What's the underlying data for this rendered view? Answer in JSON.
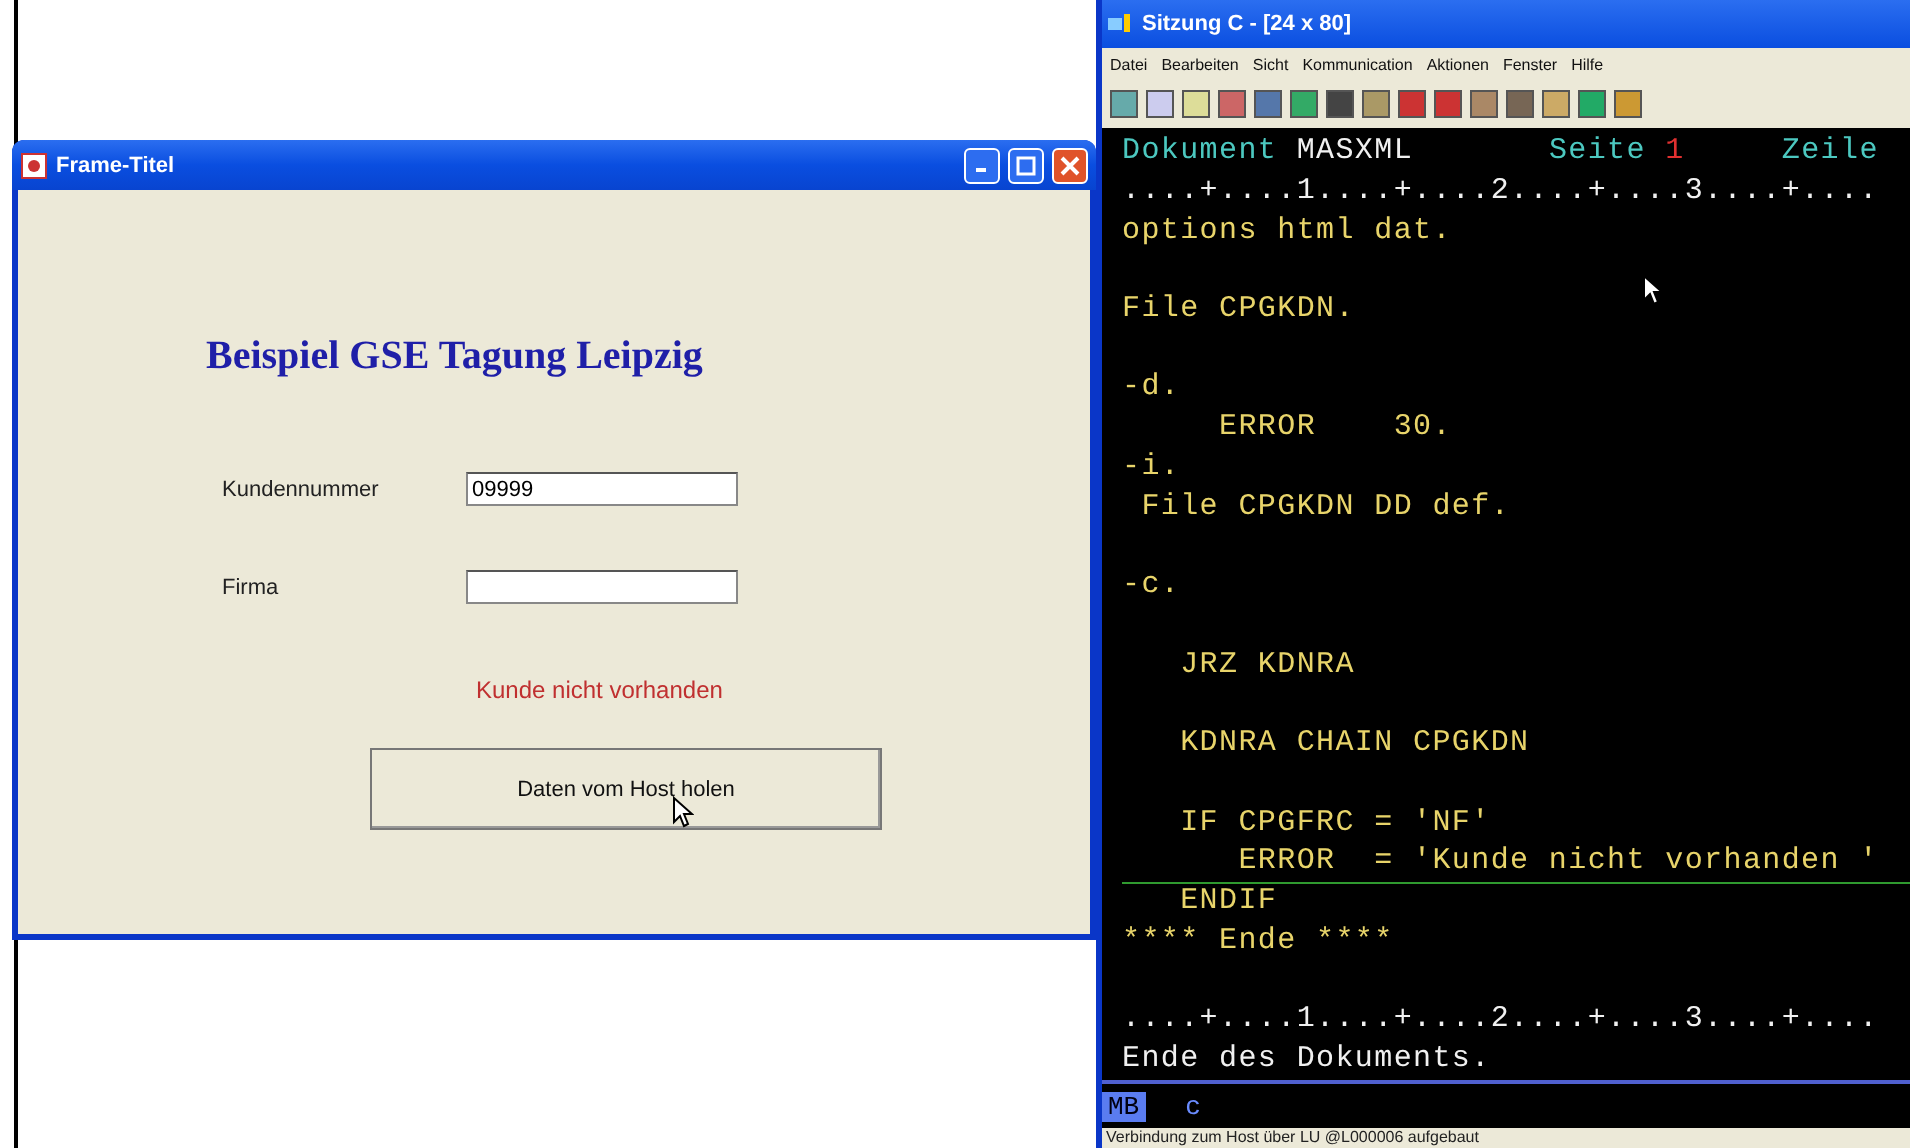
{
  "frame_window": {
    "title": "Frame-Titel",
    "heading": "Beispiel GSE Tagung Leipzig",
    "fields": [
      {
        "label": "Kundennummer",
        "value": "09999"
      },
      {
        "label": "Firma"
      }
    ],
    "message": "Kunde nicht vorhanden",
    "button": "Daten vom Host holen"
  },
  "terminal_window": {
    "title": "Sitzung C - [24 x 80]",
    "menu": [
      "Datei",
      "Bearbeiten",
      "Sicht",
      "Kommunication",
      "Aktionen",
      "Fenster",
      "Hilfe"
    ],
    "lines": [
      {
        "kind": "text",
        "segments": [
          {
            "kind": "label",
            "text": "Dokument "
          },
          {
            "kind": "value",
            "text": "MASXML"
          },
          {
            "kind": "label",
            "text": "       Seite "
          },
          {
            "kind": "number",
            "text": "1"
          },
          {
            "kind": "label",
            "text": "     Zeile"
          }
        ]
      },
      {
        "kind": "text",
        "segments": [
          {
            "kind": "value",
            "text": "....+....1....+....2....+....3....+...."
          }
        ]
      },
      {
        "kind": "text",
        "segments": [
          {
            "kind": "code",
            "text": "options html dat."
          }
        ]
      },
      {
        "kind": "blank"
      },
      {
        "kind": "text",
        "segments": [
          {
            "kind": "code",
            "text": "File CPGKDN."
          }
        ]
      },
      {
        "kind": "blank"
      },
      {
        "kind": "text",
        "segments": [
          {
            "kind": "code",
            "text": "-d."
          }
        ]
      },
      {
        "kind": "text",
        "segments": [
          {
            "kind": "code",
            "text": "     ERROR    30."
          }
        ]
      },
      {
        "kind": "text",
        "segments": [
          {
            "kind": "code",
            "text": "-i."
          }
        ]
      },
      {
        "kind": "text",
        "segments": [
          {
            "kind": "code",
            "text": " File CPGKDN DD def."
          }
        ]
      },
      {
        "kind": "blank"
      },
      {
        "kind": "text",
        "segments": [
          {
            "kind": "code",
            "text": "-c."
          }
        ]
      },
      {
        "kind": "blank"
      },
      {
        "kind": "text",
        "segments": [
          {
            "kind": "code",
            "text": "   JRZ KDNRA"
          }
        ]
      },
      {
        "kind": "blank"
      },
      {
        "kind": "text",
        "segments": [
          {
            "kind": "code",
            "text": "   KDNRA CHAIN CPGKDN"
          }
        ]
      },
      {
        "kind": "blank"
      },
      {
        "kind": "text",
        "segments": [
          {
            "kind": "code",
            "text": "   IF CPGFRC = 'NF'"
          }
        ]
      },
      {
        "kind": "text",
        "segments": [
          {
            "kind": "code",
            "text": "      ERROR  = 'Kunde nicht vorhanden '"
          }
        ]
      },
      {
        "kind": "text",
        "segments": [
          {
            "kind": "code",
            "text": "   ENDIF"
          }
        ]
      },
      {
        "kind": "text",
        "segments": [
          {
            "kind": "code",
            "text": "**** Ende ****"
          }
        ]
      },
      {
        "kind": "blank"
      },
      {
        "kind": "text",
        "segments": [
          {
            "kind": "value",
            "text": "....+....1....+....2....+....3....+...."
          }
        ]
      },
      {
        "kind": "text",
        "segments": [
          {
            "kind": "value",
            "text": "Ende des Dokuments."
          }
        ]
      }
    ],
    "indicator": "MB",
    "input_mode": "c",
    "status": "Verbindung zum Host über LU @L000006 aufgebaut"
  }
}
